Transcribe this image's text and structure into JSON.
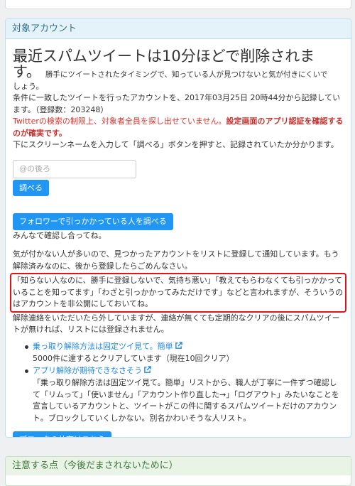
{
  "panel": {
    "heading": "対象アカウント",
    "title_line1": "最近スパムツイートは10分ほどで削除されま",
    "title_line2": "す。",
    "desc1_a": "勝手にツイートされたタイミングで、知っている人が見つけないと気が付きにくいで",
    "desc1_b": "しょう。",
    "desc2": "条件に一致したツイートを行ったアカウントを、2017年03月25日 20時44分から記録しています。（登録数：203248）",
    "warning_red": "Twitterの検索の制限上、対象者全員を探し出せていません。",
    "warning_bold": "設定画面のアプリ認証を確認するのが確実です。",
    "instruction": "下にスクリーンネームを入力して「調べる」ボタンを押すと、記録されていたか分かります。",
    "search_placeholder": "@の後ろ",
    "check_button": "調べる",
    "followers_button": "フォロワーで引っかかっている人を調べる",
    "followers_note": "みんなで確認し合ってね。",
    "para1": "気が付かない人が多いので、見つかったアカウントをリストに登録して通知しています。もう解除済みなのに、後から登録したらごめんなさい。",
    "highlight_text": "「知らない人なのに、勝手に登録しないで、気持ち悪い」「教えてもらわなくても引っかかっていることを知ってます」「わざと引っかかってみただけです」などと言われますが、そういうのはアカウントを非公開にしておいてね。",
    "para2": "解除連絡をいただいたら外していますが、連絡が無くても定期的なクリアの後にスパムツイートが無ければ、リストには登録されません。",
    "list": [
      {
        "link": "乗っ取り解除方法は固定ツイ見て。簡単",
        "text": "5000件に達するとクリアしています（現在10回クリア）"
      },
      {
        "link": "アプリ解除が期待できなさそう",
        "text": "「乗っ取り解除方法は固定ツイ見て。簡単」リストから、職人が丁寧に一件ずつ確認して「リムって」「使いません」「アカウント作り直した→」「ログアウト」みたいなことを宣言しているアカウントと、ツイートがこの件に関するスパムツイートだけのアカウント。ブロックしていくしかない。別名かわいそうな人リスト。"
      }
    ],
    "block_button": "ブロックの共有はこちら"
  },
  "panel2": {
    "heading": "注意する点（今後だまされないために）"
  },
  "colors": {
    "button": "#2196f3",
    "link": "#1e88e5",
    "warning": "#d9342a",
    "highlight_border": "#e1141b"
  }
}
